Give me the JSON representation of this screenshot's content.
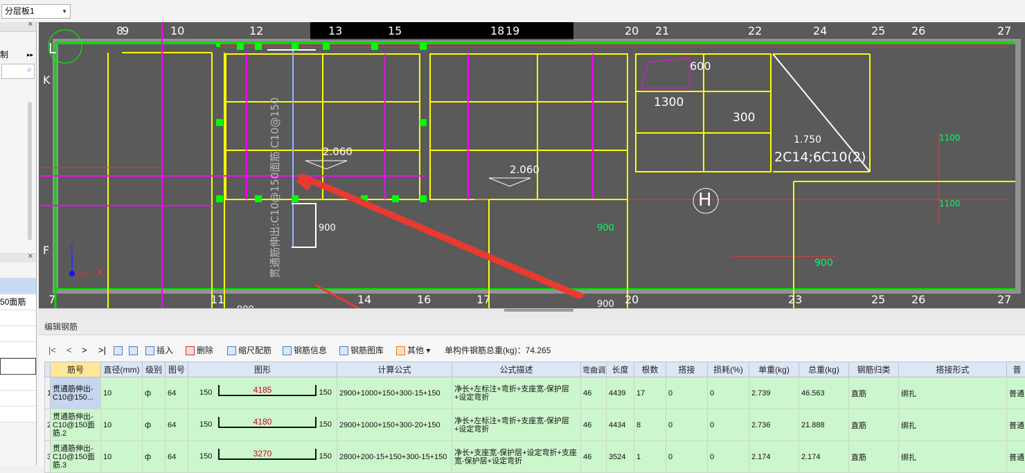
{
  "floor_select": {
    "value": "分层板1"
  },
  "left_panel": {
    "label_zhi": "制",
    "item_selected": "",
    "item_text": "50面筋"
  },
  "cad": {
    "axis_top": [
      "8",
      "9",
      "10",
      "12",
      "13",
      "15",
      "18",
      "19",
      "20",
      "21",
      "22",
      "24",
      "25",
      "26",
      "27"
    ],
    "axis_bottom": [
      "7",
      "11",
      "14",
      "16",
      "17",
      "20",
      "23",
      "25",
      "26",
      "27"
    ],
    "axis_left": [
      "K",
      "F"
    ],
    "dims": {
      "d600": "600",
      "d1300": "1300",
      "d300": "300",
      "d1750": "1.750",
      "d2060a": "2.060",
      "d2060b": "2.060",
      "d900a": "900",
      "d900b": "900",
      "d900c": "900",
      "d900d": "900",
      "d900e": "900",
      "d1100a": "1100",
      "d1100b": "1100",
      "rebar_label": "2C14;6C10(2)",
      "vert_label": "贯通筋伸出:C10@150面筋:C10@150",
      "h_label": "H",
      "l_label": "L",
      "xlabel": "X",
      "ylabel": "Y"
    }
  },
  "edit_panel": {
    "title": "编辑钢筋",
    "toolbar": {
      "nav_first": "|<",
      "nav_prev": "<",
      "nav_next": ">",
      "nav_last": ">|",
      "insert": "插入",
      "delete": "删除",
      "scale": "缩尺配筋",
      "info": "钢筋信息",
      "library": "钢筋图库",
      "other": "其他",
      "total_weight": "单构件钢筋总重(kg)：74.265"
    },
    "headers": [
      "筋号",
      "直径(mm)",
      "级别",
      "图号",
      "图形",
      "计算公式",
      "公式描述",
      "弯曲调整",
      "长度",
      "根数",
      "搭接",
      "损耗(%)",
      "单重(kg)",
      "总重(kg)",
      "钢筋归类",
      "搭接形式",
      "普"
    ],
    "rows": [
      {
        "num": "1",
        "name": "贯通筋伸出-C10@150...",
        "dia": "10",
        "grade": "ф",
        "fig": "64",
        "left": "150",
        "mid": "4185",
        "right": "150",
        "formula": "2900+1000+150+300-15+150",
        "desc": "净长+左标注+弯折+支座宽-保护层+设定弯折",
        "bend": "46",
        "len": "4439",
        "count": "17",
        "lap": "0",
        "loss": "0",
        "unit": "2.739",
        "total": "46.563",
        "cat": "直筋",
        "laptype": "绑扎",
        "extra": "普通"
      },
      {
        "num": "2",
        "name": "贯通筋伸出-C10@150面筋.2",
        "dia": "10",
        "grade": "ф",
        "fig": "64",
        "left": "150",
        "mid": "4180",
        "right": "150",
        "formula": "2900+1000+150+300-20+150",
        "desc": "净长+左标注+弯折+支座宽-保护层+设定弯折",
        "bend": "46",
        "len": "4434",
        "count": "8",
        "lap": "0",
        "loss": "0",
        "unit": "2.736",
        "total": "21.888",
        "cat": "直筋",
        "laptype": "绑扎",
        "extra": "普通"
      },
      {
        "num": "3",
        "name": "贯通筋伸出-C10@150面筋.3",
        "dia": "10",
        "grade": "ф",
        "fig": "64",
        "left": "150",
        "mid": "3270",
        "right": "150",
        "formula": "2800+200-15+150+300-15+150",
        "desc": "净长+支座宽-保护层+设定弯折+支座宽-保护层+设定弯折",
        "bend": "46",
        "len": "3524",
        "count": "1",
        "lap": "0",
        "loss": "0",
        "unit": "2.174",
        "total": "2.174",
        "cat": "直筋",
        "laptype": "绑扎",
        "extra": "普通"
      }
    ]
  }
}
